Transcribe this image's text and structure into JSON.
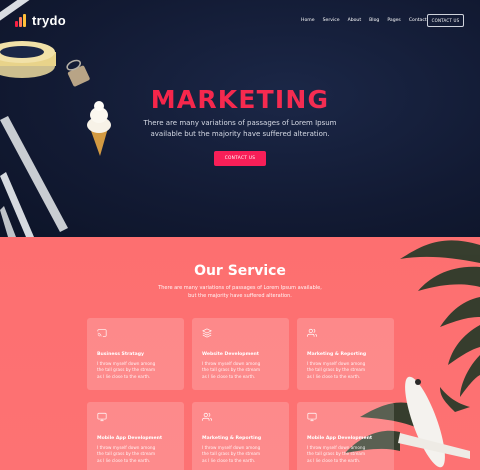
{
  "brand": {
    "name": "trydo"
  },
  "nav": {
    "items": [
      "Home",
      "Service",
      "About",
      "Blog",
      "Pages",
      "Contact"
    ],
    "cta": "CONTACT US"
  },
  "hero": {
    "title": "MARKETING",
    "subtitle": "There are many variations of passages of Lorem Ipsum available but the majority have suffered alteration.",
    "button": "CONTACT US"
  },
  "service": {
    "title": "Our Service",
    "subtitle": "There are many variations of passages of Lorem Ipsum available, but the majority have suffered alteration.",
    "cards": [
      {
        "icon": "cast-icon",
        "title": "Business Stratagy",
        "text": "I throw myself down among the tall grass by the stream as I lie close to the earth."
      },
      {
        "icon": "layers-icon",
        "title": "Website Development",
        "text": "I throw myself down among the tall grass by the stream as I lie close to the earth."
      },
      {
        "icon": "users-icon",
        "title": "Marketing & Reporting",
        "text": "I throw myself down among the tall grass by the stream as I lie close to the earth."
      },
      {
        "icon": "monitor-icon",
        "title": "Mobile App Development",
        "text": "I throw myself down among the tall grass by the stream as I lie close to the earth."
      },
      {
        "icon": "users-icon",
        "title": "Marketing & Reporting",
        "text": "I throw myself down among the tall grass by the stream as I lie close to the earth."
      },
      {
        "icon": "monitor-icon",
        "title": "Mobile App Development",
        "text": "I throw myself down among the tall grass by the stream as I lie close to the earth."
      }
    ]
  },
  "colors": {
    "accent": "#f81f58",
    "hero_bg": "#141c36",
    "service_bg": "#fd6f70"
  }
}
